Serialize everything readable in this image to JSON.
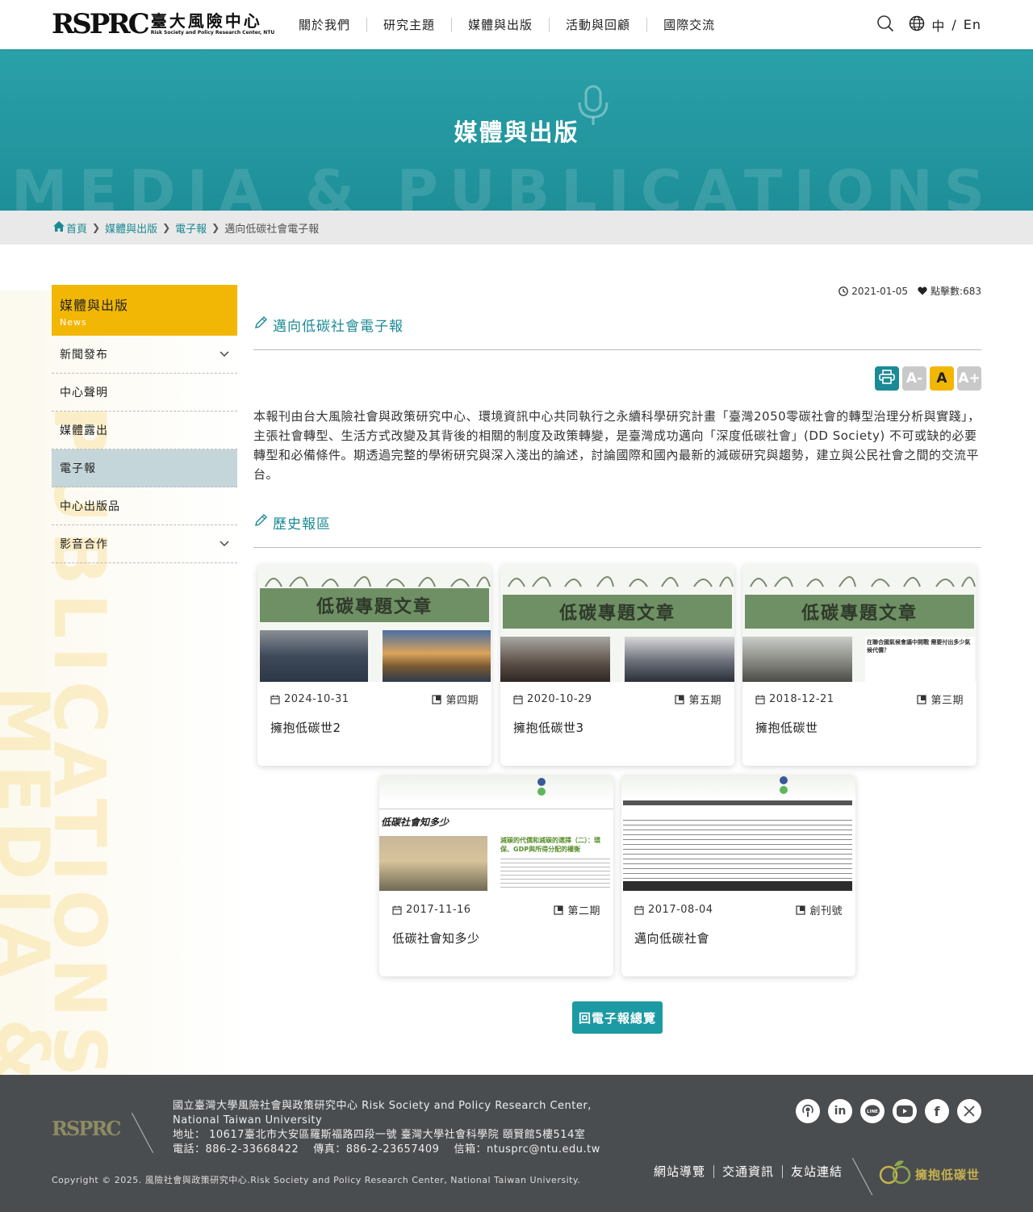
{
  "header": {
    "logo_mark": "RSPRC",
    "logo_zh": "臺大風險中心",
    "logo_en": "Risk Society and Policy Research Center, NTU",
    "nav": [
      "關於我們",
      "研究主題",
      "媒體與出版",
      "活動與回顧",
      "國際交流"
    ],
    "lang_zh": "中",
    "lang_sep": "/",
    "lang_en": "En"
  },
  "banner": {
    "title": "媒體與出版",
    "bg_text": "MEDIA & PUBLICATIONS"
  },
  "breadcrumb": {
    "home": "首頁",
    "level1": "媒體與出版",
    "level2": "電子報",
    "current": "邁向低碳社會電子報"
  },
  "side_deco": {
    "line1": "PUBLICATIONS",
    "line2": "MEDIA &"
  },
  "sidebar": {
    "title": "媒體與出版",
    "subtitle": "News",
    "items": [
      {
        "label": "新聞發布",
        "has_children": true
      },
      {
        "label": "中心聲明",
        "has_children": false
      },
      {
        "label": "媒體露出",
        "has_children": false
      },
      {
        "label": "電子報",
        "has_children": false,
        "active": true
      },
      {
        "label": "中心出版品",
        "has_children": false
      },
      {
        "label": "影音合作",
        "has_children": true
      }
    ]
  },
  "article": {
    "date": "2021-01-05",
    "clicks": "點擊數:683",
    "title": "邁向低碳社會電子報",
    "font_minus": "A-",
    "font_normal": "A",
    "font_plus": "A+",
    "description": "本報刊由台大風險社會與政策研究中心、環境資訊中心共同執行之永續科學研究計畫「臺灣2050零碳社會的轉型治理分析與實踐」，主張社會轉型、生活方式改變及其背後的相關的制度及政策轉變，是臺灣成功邁向「深度低碳社會」(DD Society) 不可或缺的必要轉型和必備條件。期透過完整的學術研究與深入淺出的論述，討論國際和國內最新的減碳研究與趨勢，建立與公民社會之間的交流平台。",
    "history_title": "歷史報區"
  },
  "cards": [
    {
      "banner": "低碳專題文章",
      "date": "2024-10-31",
      "issue": "第四期",
      "title": "擁抱低碳世2"
    },
    {
      "banner": "低碳專題文章",
      "date": "2020-10-29",
      "issue": "第五期",
      "title": "擁抱低碳世3"
    },
    {
      "banner": "低碳專題文章",
      "date": "2018-12-21",
      "issue": "第三期",
      "title": "擁抱低碳世",
      "inset": "在聯合國氣候會議中開戰 需要付出多少氣候代價？"
    },
    {
      "banner": "低碳社會知多少",
      "date": "2017-11-16",
      "issue": "第二期",
      "title": "低碳社會知多少",
      "inset": "減碳的代價和減碳的選擇（二）：環保、GDP與所得分配的權衡"
    },
    {
      "banner": "",
      "date": "2017-08-04",
      "issue": "創刊號",
      "title": "邁向低碳社會"
    }
  ],
  "back_button": "回電子報總覽",
  "footer": {
    "logo": "RSPRC",
    "org_line1": "國立臺灣大學風險社會與政策研究中心 Risk Society and Policy Research Center,",
    "org_line2": "National Taiwan University",
    "address": "地址： 10617臺北市大安區羅斯福路四段一號 臺灣大學社會科學院 頤賢館5樓514室",
    "contact": "電話：886-2-33668422　 傳真：886-2-23657409　 信箱：ntusprc@ntu.edu.tw",
    "copyright": "Copyright © 2025. 風險社會與政策研究中心.Risk Society and Policy Research Center, National Taiwan University.",
    "links": [
      "網站導覽",
      "交通資訊",
      "友站連結"
    ],
    "badge": "擁抱低碳世",
    "socials": [
      "podcast-icon",
      "linkedin-icon",
      "line-icon",
      "youtube-icon",
      "facebook-icon",
      "x-icon"
    ]
  },
  "colors": {
    "teal": "#1c8a95",
    "banner": "#2aa0a8",
    "yellow": "#f2b705",
    "active_side": "#c5d6da",
    "footer": "#4a4d50"
  }
}
